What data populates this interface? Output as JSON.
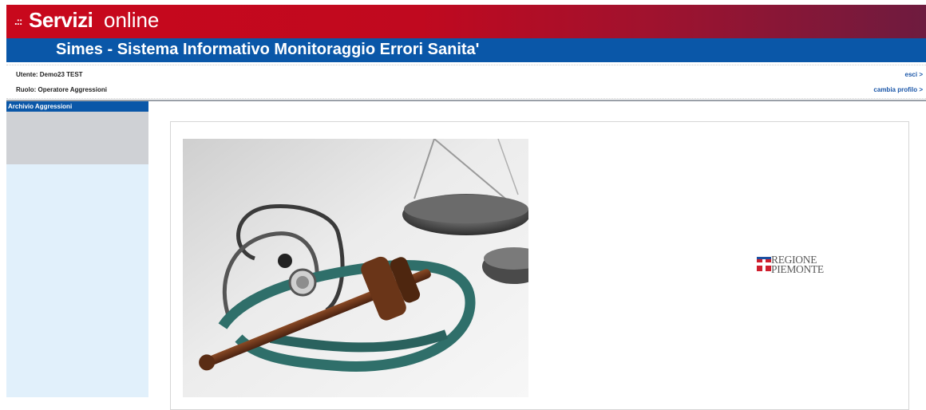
{
  "brand": {
    "dots": ".::",
    "bold": "Servizi",
    "light": "online"
  },
  "app": {
    "title": "Simes - Sistema Informativo Monitoraggio Errori Sanita'"
  },
  "user": {
    "line1": "Utente: Demo23 TEST",
    "line2": "Ruolo: Operatore Aggressioni"
  },
  "links": {
    "esci": "esci >",
    "cambia_profilo": "cambia profilo >"
  },
  "sidebar": {
    "header": "Archivio Aggressioni"
  },
  "logo": {
    "line1": "REGIONE",
    "line2": "PIEMONTE"
  },
  "colors": {
    "brand_red": "#c8081c",
    "brand_blue": "#0a57a8",
    "sidebar_bg": "#e1f0fb"
  }
}
